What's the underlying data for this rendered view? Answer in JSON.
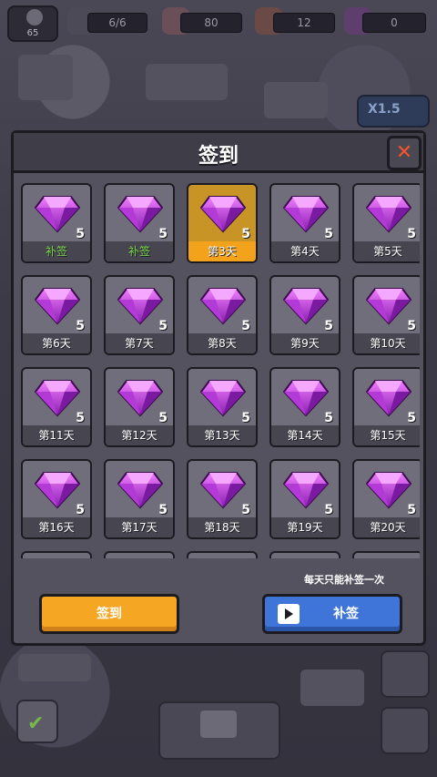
{
  "hud": {
    "level": "65",
    "energy": "6/6",
    "resource_a": "80",
    "resource_b": "12",
    "gems": "0"
  },
  "speed_badge": "X1.5",
  "dialog": {
    "title": "签到",
    "close_icon": "close-icon",
    "days": [
      {
        "amount": "5",
        "label": "补签",
        "state": "makeup"
      },
      {
        "amount": "5",
        "label": "补签",
        "state": "makeup"
      },
      {
        "amount": "5",
        "label": "第3天",
        "state": "today"
      },
      {
        "amount": "5",
        "label": "第4天",
        "state": "normal"
      },
      {
        "amount": "5",
        "label": "第5天",
        "state": "normal"
      },
      {
        "amount": "5",
        "label": "第6天",
        "state": "normal"
      },
      {
        "amount": "5",
        "label": "第7天",
        "state": "normal"
      },
      {
        "amount": "5",
        "label": "第8天",
        "state": "normal"
      },
      {
        "amount": "5",
        "label": "第9天",
        "state": "normal"
      },
      {
        "amount": "5",
        "label": "第10天",
        "state": "normal"
      },
      {
        "amount": "5",
        "label": "第11天",
        "state": "normal"
      },
      {
        "amount": "5",
        "label": "第12天",
        "state": "normal"
      },
      {
        "amount": "5",
        "label": "第13天",
        "state": "normal"
      },
      {
        "amount": "5",
        "label": "第14天",
        "state": "normal"
      },
      {
        "amount": "5",
        "label": "第15天",
        "state": "normal"
      },
      {
        "amount": "5",
        "label": "第16天",
        "state": "normal"
      },
      {
        "amount": "5",
        "label": "第17天",
        "state": "normal"
      },
      {
        "amount": "5",
        "label": "第18天",
        "state": "normal"
      },
      {
        "amount": "5",
        "label": "第19天",
        "state": "normal"
      },
      {
        "amount": "5",
        "label": "第20天",
        "state": "normal"
      }
    ],
    "note": "每天只能补签一次",
    "signin_label": "签到",
    "makeup_label": "补签"
  },
  "colors": {
    "gem": "#c23be0",
    "today": "#f2a31b",
    "makeup_text": "#7bd84a",
    "signin_button": "#f5a623",
    "makeup_button": "#3f74d8"
  }
}
